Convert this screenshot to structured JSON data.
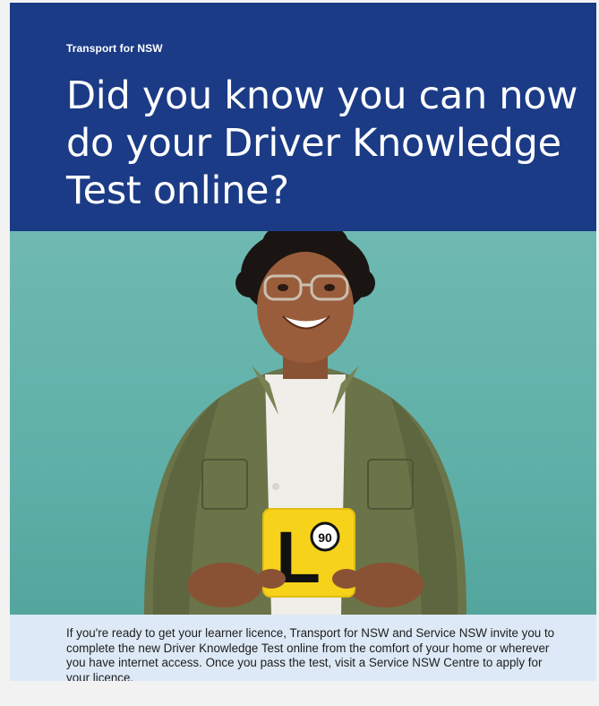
{
  "header": {
    "kicker": "Transport for NSW",
    "headline": "Did you know you can now do your Driver Knowledge Test online?",
    "background_color": "#1b3b86"
  },
  "hero": {
    "plate_letter": "L",
    "plate_speed": "90",
    "background_color": "#5fb0a8",
    "plate_color": "#f6d21a"
  },
  "body": {
    "text": "If you're ready to get your learner licence, Transport for NSW and Service NSW invite you to complete the new Driver Knowledge Test online from the comfort of your home or wherever you have internet access. Once you pass the test, visit a Service NSW Centre to apply for your licence.",
    "background_color": "#dde9f6"
  }
}
